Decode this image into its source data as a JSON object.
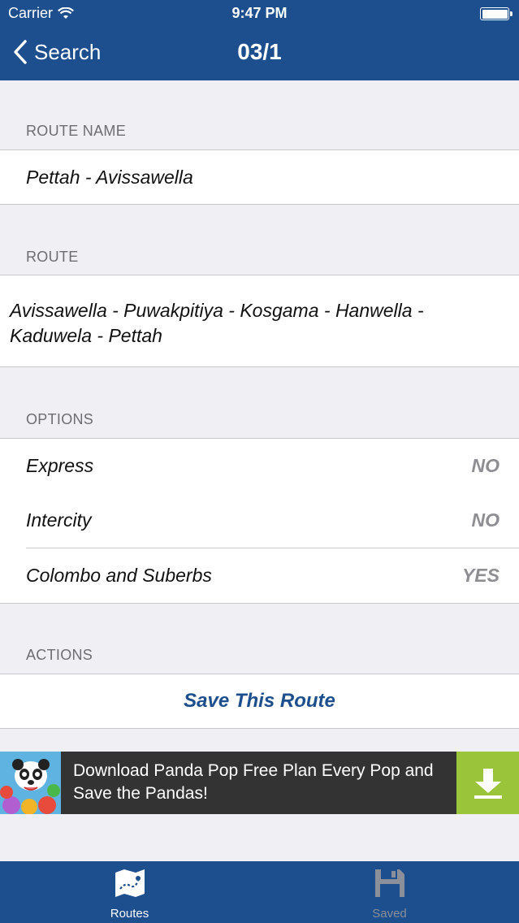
{
  "status_bar": {
    "carrier": "Carrier",
    "time": "9:47 PM"
  },
  "nav": {
    "back_label": "Search",
    "title": "03/1"
  },
  "sections": {
    "route_name": {
      "header": "ROUTE NAME",
      "value": "Pettah - Avissawella"
    },
    "route": {
      "header": "ROUTE",
      "value_line1": "Avissawella - Puwakpitiya - Kosgama - Hanwella -",
      "value_line2": "Kaduwela - Pettah"
    },
    "options": {
      "header": "OPTIONS",
      "rows": [
        {
          "label": "Express",
          "value": "NO"
        },
        {
          "label": "Intercity",
          "value": "NO"
        },
        {
          "label": "Colombo and Suberbs",
          "value": "YES"
        }
      ]
    },
    "actions": {
      "header": "ACTIONS",
      "save_label": "Save This Route"
    }
  },
  "ad": {
    "text": "Download Panda Pop Free Plan Every Pop and Save the Pandas!",
    "accent": "#9ac43a"
  },
  "tabs": [
    {
      "label": "Routes",
      "icon": "map-icon",
      "active": true
    },
    {
      "label": "Saved",
      "icon": "floppy-disk-icon",
      "active": false
    }
  ],
  "colors": {
    "bar": "#1d4f8e",
    "background": "#efeff4",
    "value_gray": "#8e8e93"
  }
}
